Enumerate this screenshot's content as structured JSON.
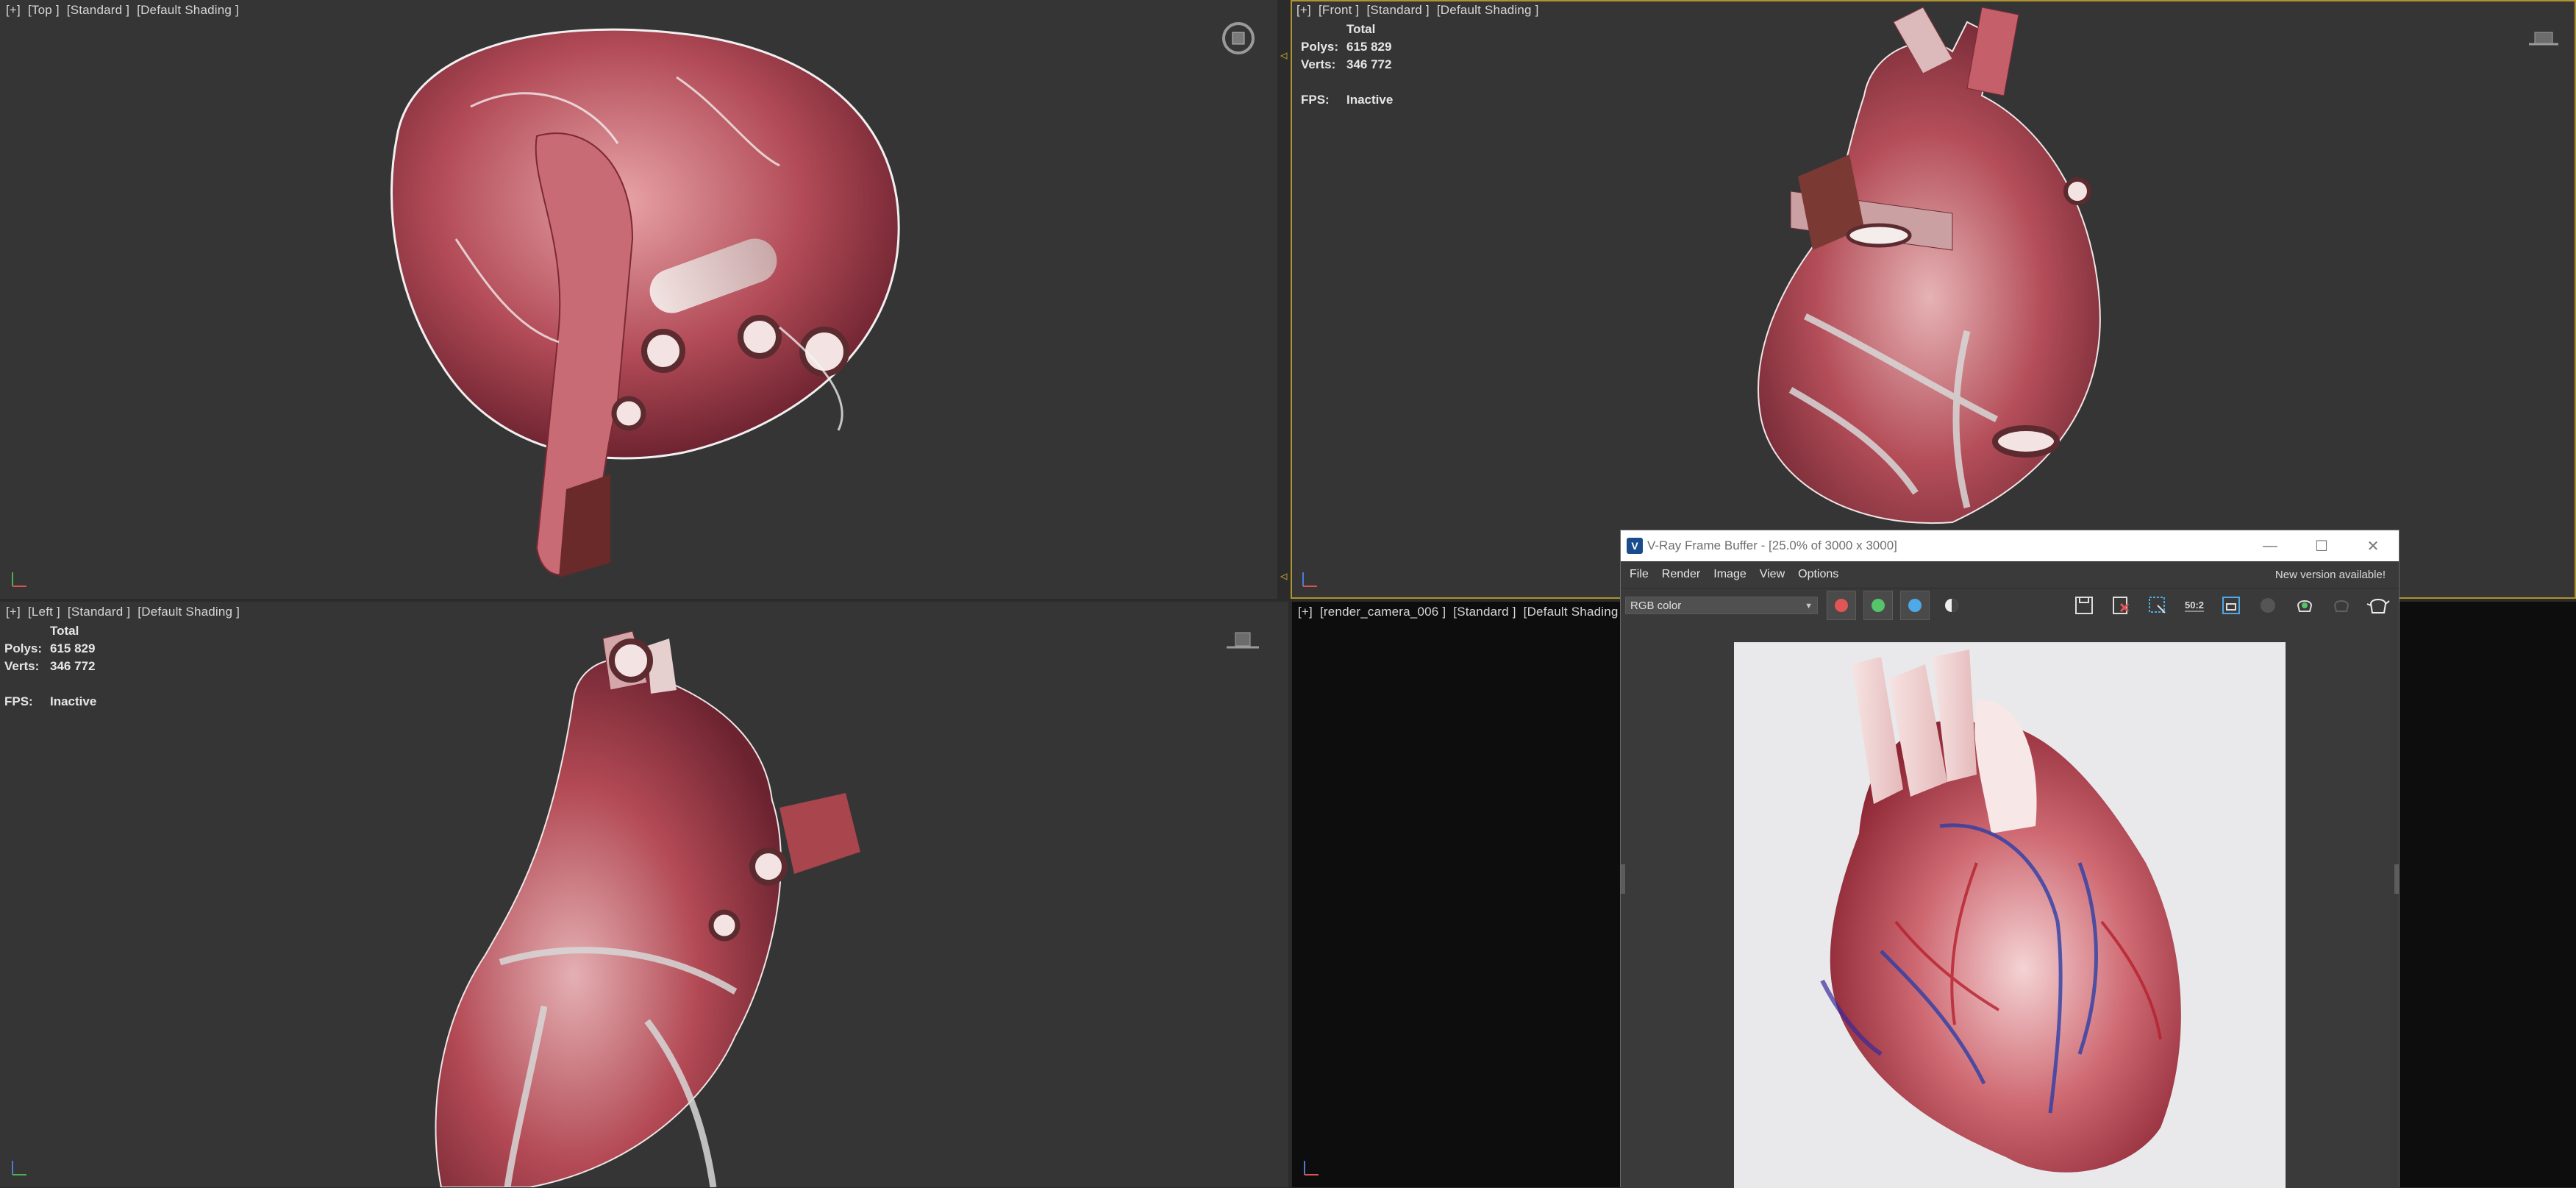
{
  "viewports": {
    "top": {
      "label": [
        "[+]",
        "[Top ]",
        "[Standard ]",
        "[Default Shading ]"
      ]
    },
    "front": {
      "label": [
        "[+]",
        "[Front ]",
        "[Standard ]",
        "[Default Shading ]"
      ],
      "stats": {
        "total": "Total",
        "polys_label": "Polys:",
        "polys": "615 829",
        "verts_label": "Verts:",
        "verts": "346 772",
        "fps_label": "FPS:",
        "fps": "Inactive"
      }
    },
    "left": {
      "label": [
        "[+]",
        "[Left ]",
        "[Standard ]",
        "[Default Shading ]"
      ],
      "stats": {
        "total": "Total",
        "polys_label": "Polys:",
        "polys": "615 829",
        "verts_label": "Verts:",
        "verts": "346 772",
        "fps_label": "FPS:",
        "fps": "Inactive"
      }
    },
    "camera": {
      "label": [
        "[+]",
        "[render_camera_006 ]",
        "[Standard ]",
        "[Default Shading ]"
      ]
    }
  },
  "vfb": {
    "title": "V-Ray Frame Buffer - [25.0% of 3000 x 3000]",
    "menu": [
      "File",
      "Render",
      "Image",
      "View",
      "Options"
    ],
    "notice": "New version available!",
    "channel": "RGB color",
    "channel_colors": {
      "red": "#e05555",
      "green": "#55c46a",
      "blue": "#4fa9e6"
    },
    "toolbar_icons": [
      "save-icon",
      "clear-image-icon",
      "region-select-icon",
      "zoom-50-icon",
      "render-region-icon",
      "stop-render-icon",
      "render-teapot-icon",
      "render-interactive-icon",
      "teapot-render-icon"
    ],
    "zoom_badge": "50:2"
  },
  "colors": {
    "viewport_bg": "#353535",
    "active_border": "#b0932e",
    "heart_muscle": "#b34a55",
    "vessel": "#d9c8c8"
  }
}
